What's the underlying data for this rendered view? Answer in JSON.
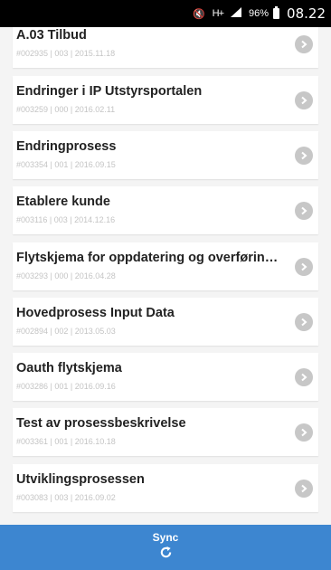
{
  "status_bar": {
    "battery_percent": "96%",
    "time": "08.22",
    "network": "H+"
  },
  "items": [
    {
      "title": "A.03 Tilbud",
      "meta": "#002935 | 003 | 2015.11.18"
    },
    {
      "title": "Endringer i IP Utstyrsportalen",
      "meta": "#003259 | 000 | 2016.02.11"
    },
    {
      "title": "Endringprosess",
      "meta": "#003354 | 001 | 2016.09.15"
    },
    {
      "title": "Etablere kunde",
      "meta": "#003116 | 003 | 2014.12.16"
    },
    {
      "title": "Flytskjema for oppdatering og overføring a...",
      "meta": "#003293 | 000 | 2016.04.28"
    },
    {
      "title": "Hovedprosess Input Data",
      "meta": "#002894 | 002 | 2013.05.03"
    },
    {
      "title": "Oauth flytskjema",
      "meta": "#003286 | 001 | 2016.09.16"
    },
    {
      "title": "Test av prosessbeskrivelse",
      "meta": "#003361 | 001 | 2016.10.18"
    },
    {
      "title": "Utviklingsprosessen",
      "meta": "#003083 | 003 | 2016.09.02"
    }
  ],
  "sync": {
    "label": "Sync"
  },
  "colors": {
    "sync_bar": "#3d86d0",
    "chevron": "#c7c7c7",
    "meta_text": "#c4c4c4"
  }
}
